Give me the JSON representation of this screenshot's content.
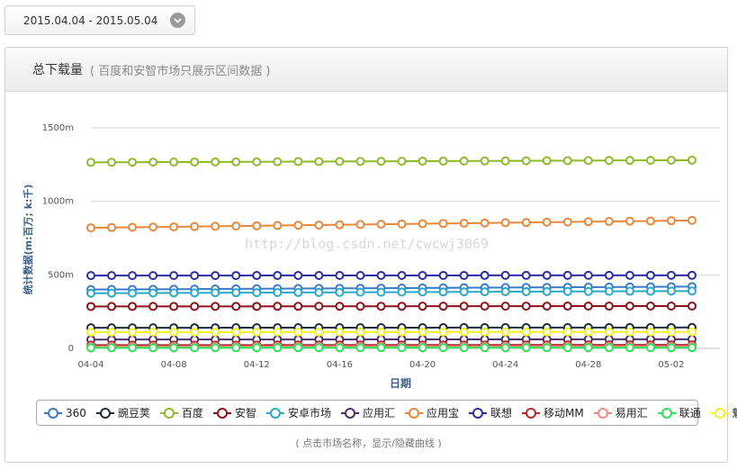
{
  "date_range": "2015.04.04 - 2015.05.04",
  "panel": {
    "title": "总下载量",
    "subtitle": "( 百度和安智市场只展示区间数据 )"
  },
  "watermark": "http://blog.csdn.net/cwcwj3069",
  "hint": "( 点击市场名称，显示/隐藏曲线 )",
  "chart_data": {
    "type": "line",
    "xlabel": "日期",
    "ylabel": "统计数据(m:百万; k:千)",
    "ylim": [
      0,
      1500
    ],
    "y_ticks": [
      {
        "value": 0,
        "label": "0"
      },
      {
        "value": 500,
        "label": "500m"
      },
      {
        "value": 1000,
        "label": "1000m"
      },
      {
        "value": 1500,
        "label": "1500m"
      }
    ],
    "x": [
      "04-04",
      "04-05",
      "04-06",
      "04-07",
      "04-08",
      "04-09",
      "04-10",
      "04-11",
      "04-12",
      "04-13",
      "04-14",
      "04-15",
      "04-16",
      "04-17",
      "04-18",
      "04-19",
      "04-20",
      "04-21",
      "04-22",
      "04-23",
      "04-24",
      "04-25",
      "04-26",
      "04-27",
      "04-28",
      "04-29",
      "04-30",
      "05-01",
      "05-02",
      "05-03"
    ],
    "x_tick_labels": [
      "04-04",
      "04-08",
      "04-12",
      "04-16",
      "04-20",
      "04-24",
      "04-28",
      "05-02"
    ],
    "series": [
      {
        "name": "360",
        "color": "#3a7cc7",
        "start": 400,
        "end": 420
      },
      {
        "name": "豌豆荚",
        "color": "#1d2f3b",
        "start": 140,
        "end": 142
      },
      {
        "name": "百度",
        "color": "#8dbb2a",
        "start": 1265,
        "end": 1280
      },
      {
        "name": "安智",
        "color": "#8e1219",
        "start": 285,
        "end": 288
      },
      {
        "name": "安卓市场",
        "color": "#2aa9c9",
        "start": 375,
        "end": 390
      },
      {
        "name": "应用汇",
        "color": "#4a2e6e",
        "start": 60,
        "end": 62
      },
      {
        "name": "应用宝",
        "color": "#e8883a",
        "start": 820,
        "end": 870
      },
      {
        "name": "联想",
        "color": "#2a2fa5",
        "start": 495,
        "end": 497
      },
      {
        "name": "移动MM",
        "color": "#b8282a",
        "start": 22,
        "end": 24
      },
      {
        "name": "易用汇",
        "color": "#ef8a84",
        "start": 12,
        "end": 14
      },
      {
        "name": "联通",
        "color": "#2ee05a",
        "start": 4,
        "end": 5
      },
      {
        "name": "魅族",
        "color": "#f2f224",
        "start": 110,
        "end": 112
      }
    ]
  }
}
